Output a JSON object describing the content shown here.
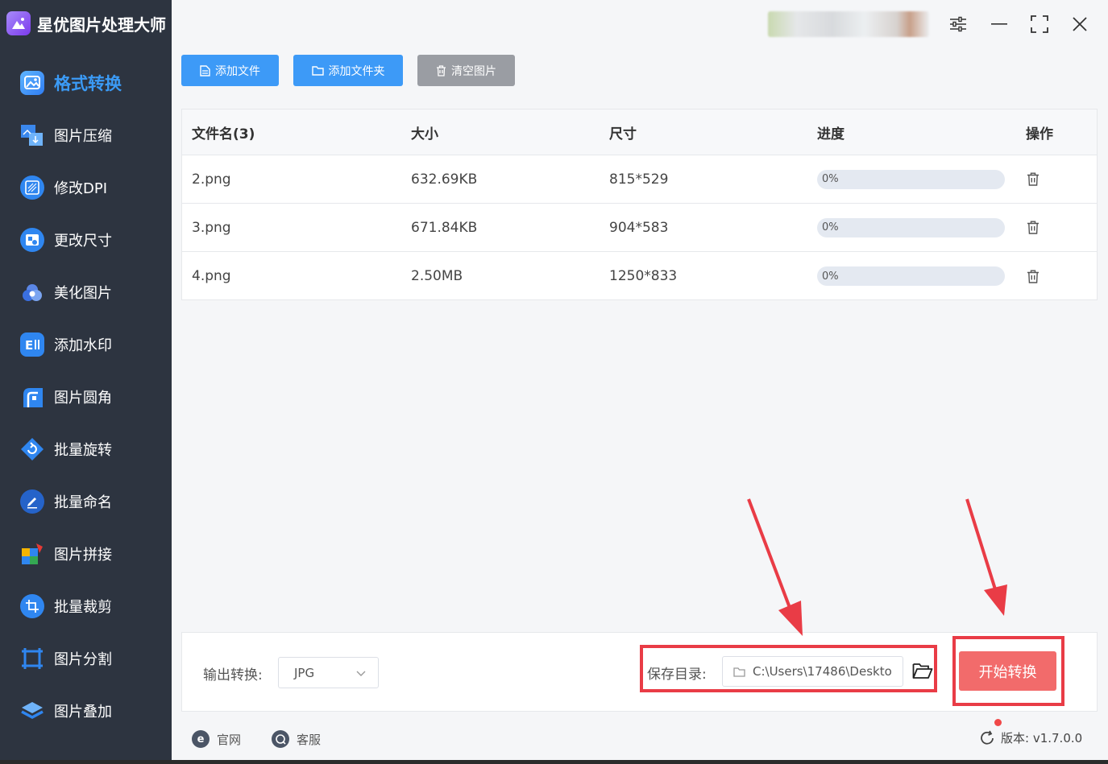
{
  "app": {
    "name": "星优图片处理大师"
  },
  "sidebar": {
    "items": [
      {
        "label": "格式转换",
        "icon": "image-format-icon",
        "active": true
      },
      {
        "label": "图片压缩",
        "icon": "image-compress-icon"
      },
      {
        "label": "修改DPI",
        "icon": "dpi-icon"
      },
      {
        "label": "更改尺寸",
        "icon": "resize-icon"
      },
      {
        "label": "美化图片",
        "icon": "beautify-icon"
      },
      {
        "label": "添加水印",
        "icon": "watermark-icon"
      },
      {
        "label": "图片圆角",
        "icon": "rounded-corner-icon"
      },
      {
        "label": "批量旋转",
        "icon": "rotate-icon"
      },
      {
        "label": "批量命名",
        "icon": "rename-icon"
      },
      {
        "label": "图片拼接",
        "icon": "puzzle-icon"
      },
      {
        "label": "批量裁剪",
        "icon": "crop-icon"
      },
      {
        "label": "图片分割",
        "icon": "split-icon"
      },
      {
        "label": "图片叠加",
        "icon": "layers-icon"
      }
    ]
  },
  "toolbar": {
    "add_file": "添加文件",
    "add_folder": "添加文件夹",
    "clear": "清空图片"
  },
  "table": {
    "headers": {
      "name": "文件名(3)",
      "size": "大小",
      "dims": "尺寸",
      "progress": "进度",
      "action": "操作"
    },
    "rows": [
      {
        "name": "2.png",
        "size": "632.69KB",
        "dims": "815*529",
        "progress": "0%"
      },
      {
        "name": "3.png",
        "size": "671.84KB",
        "dims": "904*583",
        "progress": "0%"
      },
      {
        "name": "4.png",
        "size": "2.50MB",
        "dims": "1250*833",
        "progress": "0%"
      }
    ]
  },
  "output": {
    "label": "输出转换:",
    "format": "JPG",
    "save_label": "保存目录:",
    "save_path": "C:\\Users\\17486\\Deskto",
    "start": "开始转换"
  },
  "footer": {
    "website": "官网",
    "support": "客服",
    "version": "版本: v1.7.0.0"
  },
  "colors": {
    "sidebar": "#2d3440",
    "accent": "#3d9af7",
    "start": "#f26b6b",
    "annotation": "#e93c46"
  }
}
